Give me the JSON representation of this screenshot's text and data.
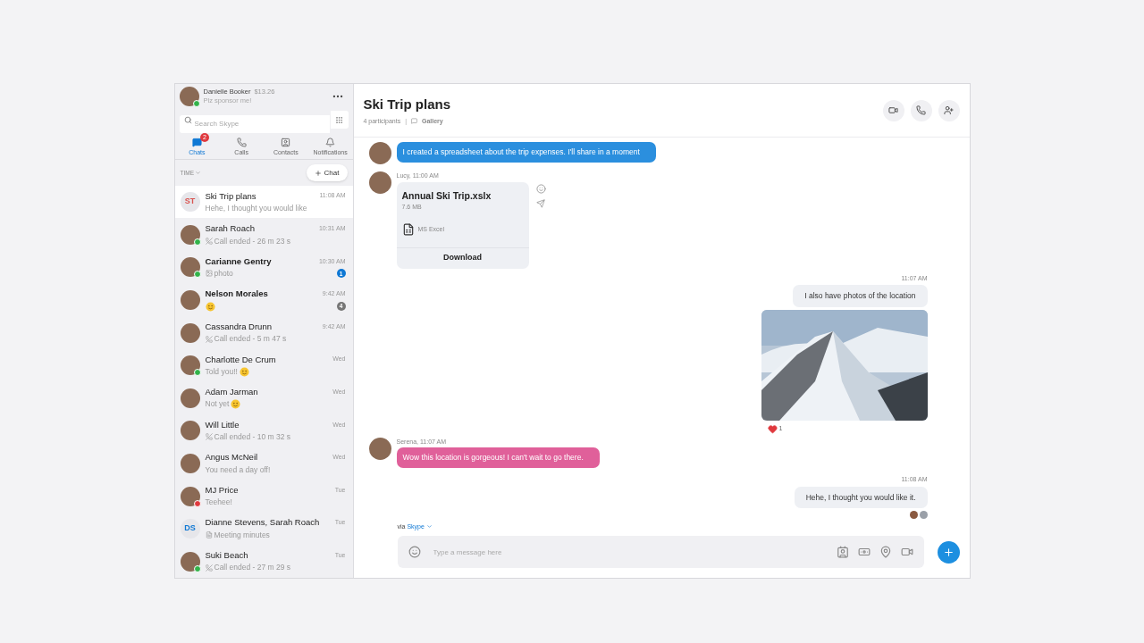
{
  "profile": {
    "name": "Danielle Booker",
    "credit": "$13.26",
    "status": "Plz sponsor me!",
    "presence": {
      "color": "#32b34a"
    }
  },
  "search": {
    "placeholder": "Search Skype"
  },
  "nav_tabs": [
    {
      "kind": "chats",
      "label": "Chats",
      "selected": true,
      "badge": "2"
    },
    {
      "kind": "calls",
      "label": "Calls",
      "selected": false
    },
    {
      "kind": "contacts",
      "label": "Contacts",
      "selected": false
    },
    {
      "kind": "notifications",
      "label": "Notifications",
      "selected": false
    }
  ],
  "sort": {
    "label": "TIME"
  },
  "new_chat": {
    "label": "Chat"
  },
  "chats": [
    {
      "kind": "text",
      "name": "Ski Trip plans",
      "time": "11:08 AM",
      "preview": "Hehe, I thought you would like",
      "initials": {
        "text": "ST",
        "color": "#d9534f"
      },
      "selected": true
    },
    {
      "kind": "call",
      "name": "Sarah Roach",
      "time": "10:31 AM",
      "preview": "Call ended - 26 m 23 s",
      "presence": {
        "color": "#32b34a"
      },
      "selected": false
    },
    {
      "kind": "photo",
      "name": "Carianne Gentry",
      "time": "10:30 AM",
      "preview": "photo",
      "presence": {
        "color": "#32b34a"
      },
      "unread": {
        "count": "1",
        "color": "#0f78d4"
      },
      "selected": false
    },
    {
      "kind": "emoji",
      "name": "Nelson Morales",
      "time": "9:42 AM",
      "unread": {
        "count": "4",
        "color": "#767676"
      },
      "selected": false
    },
    {
      "kind": "call",
      "name": "Cassandra Drunn",
      "time": "9:42 AM",
      "preview": "Call ended - 5 m 47 s",
      "selected": false
    },
    {
      "kind": "emoji",
      "name": "Charlotte De Crum",
      "time": "Wed",
      "preview": "Told you!!",
      "presence": {
        "color": "#32b34a"
      },
      "selected": false
    },
    {
      "kind": "emoji",
      "name": "Adam Jarman",
      "time": "Wed",
      "preview": "Not yet",
      "selected": false
    },
    {
      "kind": "call",
      "name": "Will Little",
      "time": "Wed",
      "preview": "Call ended - 10 m 32 s",
      "selected": false
    },
    {
      "kind": "text",
      "name": "Angus McNeil",
      "time": "Wed",
      "preview": "You need a day off!",
      "selected": false
    },
    {
      "kind": "text",
      "name": "MJ Price",
      "time": "Tue",
      "preview": "Teehee!",
      "presence": {
        "color": "#e0393e"
      },
      "selected": false
    },
    {
      "kind": "file",
      "name": "Dianne Stevens, Sarah Roach",
      "time": "Tue",
      "preview": "Meeting minutes",
      "initials": {
        "text": "DS",
        "color": "#0f78d4"
      },
      "selected": false
    },
    {
      "kind": "call",
      "name": "Suki Beach",
      "time": "Tue",
      "preview": "Call ended - 27 m 29 s",
      "presence": {
        "color": "#32b34a"
      },
      "selected": false
    }
  ],
  "conversation": {
    "title": "Ski Trip plans",
    "participants": "4 participants",
    "separator": "|",
    "gallery": "Gallery"
  },
  "messages": [
    {
      "kind": "incoming",
      "text": "I created a spreadsheet about the trip expenses. I'll share in a moment",
      "color": "#2b8fde"
    },
    {
      "kind": "file",
      "header": "Lucy, 11:00 AM",
      "file_name": "Annual Ski Trip.xslx",
      "size": "7.6 MB",
      "app": "MS Excel",
      "action": "Download"
    },
    {
      "kind": "outgoing",
      "time": "11:07 AM",
      "text": "I also have photos of the location"
    },
    {
      "kind": "photo",
      "reaction_count": "1"
    },
    {
      "kind": "incoming",
      "header": "Serena, 11:07 AM",
      "text": "Wow this location is gorgeous! I can't wait to go there.",
      "color": "#e0609a"
    },
    {
      "kind": "outgoing",
      "time": "11:08 AM",
      "text": "Hehe, I thought you would like it.",
      "read_receipts": true
    }
  ],
  "composer": {
    "via": "via",
    "service": "Skype",
    "placeholder": "Type a message here"
  }
}
